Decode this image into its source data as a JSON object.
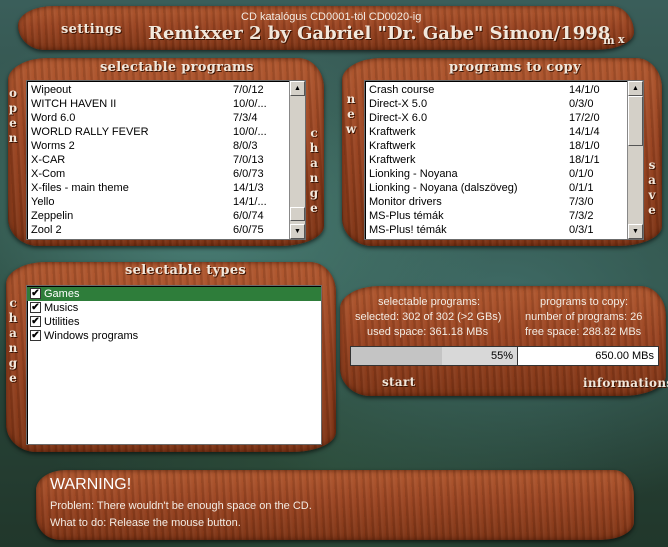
{
  "window": {
    "subtitle": "CD katalógus CD0001-töl CD0020-ig",
    "title": "Remixxer 2 by Gabriel \"Dr. Gabe\" Simon/1998",
    "settings_label": "settings",
    "min_label": "m",
    "close_label": "x"
  },
  "selectable_programs": {
    "heading": "selectable programs",
    "rows": [
      {
        "name": "Wipeout",
        "value": "7/0/12"
      },
      {
        "name": "WITCH HAVEN II",
        "value": "10/0/..."
      },
      {
        "name": "Word 6.0",
        "value": "7/3/4"
      },
      {
        "name": "WORLD RALLY FEVER",
        "value": "10/0/..."
      },
      {
        "name": "Worms 2",
        "value": "8/0/3"
      },
      {
        "name": "X-CAR",
        "value": "7/0/13"
      },
      {
        "name": "X-Com",
        "value": "6/0/73"
      },
      {
        "name": "X-files - main theme",
        "value": "14/1/3"
      },
      {
        "name": "Yello",
        "value": "14/1/..."
      },
      {
        "name": "Zeppelin",
        "value": "6/0/74"
      },
      {
        "name": "Zool 2",
        "value": "6/0/75"
      }
    ]
  },
  "programs_to_copy": {
    "heading": "programs to copy",
    "rows": [
      {
        "name": "Crash course",
        "value": "14/1/0"
      },
      {
        "name": "Direct-X 5.0",
        "value": "0/3/0"
      },
      {
        "name": "Direct-X 6.0",
        "value": "17/2/0"
      },
      {
        "name": "Kraftwerk",
        "value": "14/1/4"
      },
      {
        "name": "Kraftwerk",
        "value": "18/1/0"
      },
      {
        "name": "Kraftwerk",
        "value": "18/1/1"
      },
      {
        "name": "Lionking - Noyana",
        "value": "0/1/0"
      },
      {
        "name": "Lionking - Noyana (dalszöveg)",
        "value": "0/1/1"
      },
      {
        "name": "Monitor drivers",
        "value": "7/3/0"
      },
      {
        "name": "MS-Plus témák",
        "value": "7/3/2"
      },
      {
        "name": "MS-Plus! témák",
        "value": "0/3/1"
      }
    ]
  },
  "side_labels": {
    "open": "open",
    "change_left": "change",
    "new": "new",
    "change_mid": "change",
    "save": "save",
    "change_types": "change"
  },
  "selectable_types": {
    "heading": "selectable types",
    "items": [
      {
        "label": "Games",
        "checked": true,
        "selected": true
      },
      {
        "label": "Musics",
        "checked": true,
        "selected": false
      },
      {
        "label": "Utilities",
        "checked": true,
        "selected": false
      },
      {
        "label": "Windows programs",
        "checked": true,
        "selected": false
      }
    ]
  },
  "stats": {
    "left_title": "selectable programs:",
    "left_selected": "selected: 302 of 302 (>2 GBs)",
    "left_used": "used space: 361.18 MBs",
    "right_title": "programs to copy:",
    "right_count": "number of programs: 26",
    "right_free": "free space: 288.82 MBs",
    "progress_text": "55%",
    "progress_value": 0.55,
    "size_text": "650.00 MBs",
    "start_label": "start",
    "info_label": "informations"
  },
  "warning": {
    "title": "WARNING!",
    "problem": "Problem: There wouldn't be enough space on the CD.",
    "todo": "What to do: Release the mouse button."
  }
}
